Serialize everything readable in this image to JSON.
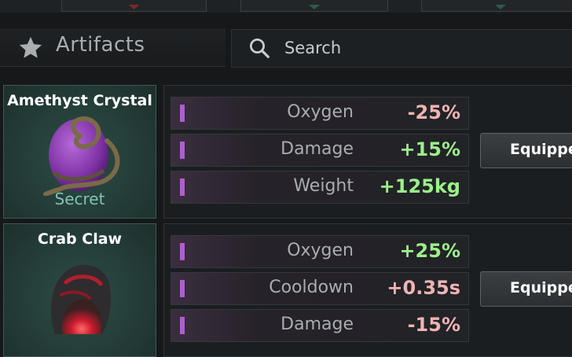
{
  "category": {
    "title": "Artifacts",
    "icon": "star-icon"
  },
  "search": {
    "placeholder": "Search",
    "icon": "search-icon"
  },
  "artifacts": [
    {
      "name": "Amethyst Crystal",
      "tag": "Secret",
      "art_icon": "amethyst-crystal-icon",
      "stats": [
        {
          "label": "Oxygen",
          "value": "-25%"
        },
        {
          "label": "Damage",
          "value": "+15%"
        },
        {
          "label": "Weight",
          "value": "+125kg"
        }
      ],
      "button": "Equipped"
    },
    {
      "name": "Crab Claw",
      "art_icon": "crab-claw-icon",
      "stats": [
        {
          "label": "Oxygen",
          "value": "+25%"
        },
        {
          "label": "Cooldown",
          "value": "+0.35s"
        },
        {
          "label": "Damage",
          "value": "-15%"
        }
      ],
      "button": "Equipped"
    }
  ],
  "colors": {
    "negative": "#f0b3b3",
    "positive": "#9cf08a",
    "accent": "#b459d6",
    "card_bg": "#2c4d46"
  }
}
